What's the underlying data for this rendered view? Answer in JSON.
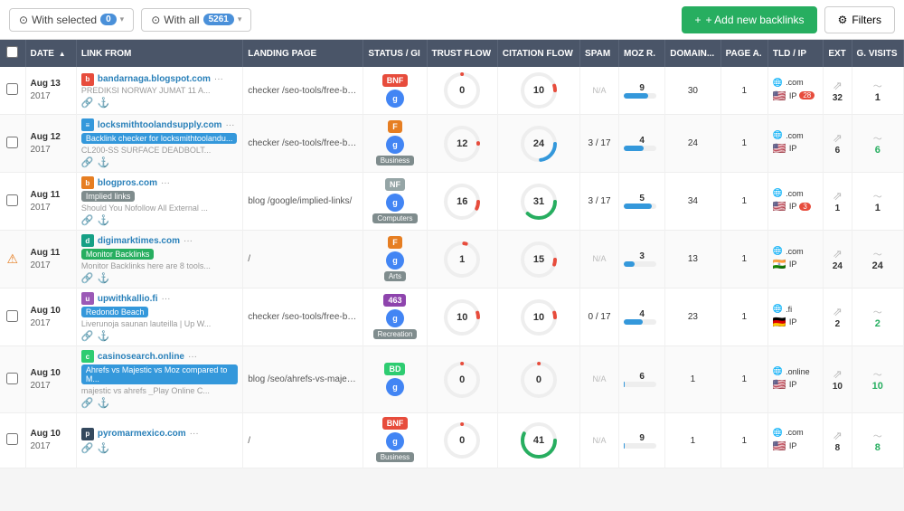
{
  "topbar": {
    "selected_label": "With selected",
    "selected_count": "0",
    "all_label": "With all",
    "all_count": "5261",
    "add_btn": "+ Add new backlinks",
    "filters_btn": "Filters"
  },
  "table": {
    "columns": [
      "DATE",
      "LINK FROM",
      "LANDING PAGE",
      "STATUS / GI",
      "TRUST FLOW",
      "CITATION FLOW",
      "SPAM",
      "MOZ R.",
      "DOMAIN...",
      "PAGE A.",
      "TLD / IP",
      "EXT",
      "G. VISITS"
    ],
    "rows": [
      {
        "date": "Aug 13\n2017",
        "domain": "bandarnaga.blogspot.com",
        "tag": "PREDIKSI NORWAY JUMAT 11 A...",
        "tag_color": "",
        "tag_label": "",
        "snippet": "PREDIKSI NORWAY JUMAT 11 A...",
        "landing": "checker /seo-tools/free-bac...",
        "status": "BNF",
        "status_class": "s-bnf",
        "trust": 0,
        "citation": 10,
        "trust_color": "#e74c3c",
        "citation_color": "#e74c3c",
        "spam": "N/A",
        "moz": 9,
        "moz_max": 30,
        "moz_bar": 30,
        "domain_a": 30,
        "page_a": 1,
        "tld": ".com",
        "flag": "🇺🇸",
        "ip_count": 28,
        "ext": 32,
        "visits": 1,
        "visits_color": "",
        "flow_label": "",
        "favicon_type": "letter",
        "favicon_color": "#e74c3c",
        "favicon_letter": "b",
        "warn": false
      },
      {
        "date": "Aug 12\n2017",
        "domain": "locksmithtoolandsupply.com",
        "tag": "Backlink checker for locksmithtoolandu...",
        "tag_color": "tag-blue",
        "tag_label": "Backlink checker for locksmithtoolandu...",
        "snippet": "CL200-SS SURFACE DEADBOLT...",
        "landing": "checker /seo-tools/free-bac...",
        "status": "F",
        "status_class": "s-f",
        "trust": 12,
        "citation": 24,
        "trust_color": "#e74c3c",
        "citation_color": "#3498db",
        "spam": "3 / 17",
        "moz": 4,
        "moz_max": 24,
        "moz_bar": 24,
        "domain_a": 24,
        "page_a": 1,
        "tld": ".com",
        "flag": "🇺🇸",
        "ip_count": 0,
        "ext": 6,
        "visits": 6,
        "visits_color": "gv-green",
        "flow_label": "Business",
        "favicon_type": "letter",
        "favicon_color": "#3498db",
        "favicon_letter": "≡",
        "warn": false
      },
      {
        "date": "Aug 11\n2017",
        "domain": "blogpros.com",
        "tag": "Implied links",
        "tag_color": "tag-gray",
        "tag_label": "Implied links",
        "snippet": "Should You Nofollow All External ...",
        "landing": "blog /google/implied-links/",
        "status": "NF",
        "status_class": "s-nf",
        "trust": 16,
        "citation": 31,
        "trust_color": "#e74c3c",
        "citation_color": "#27ae60",
        "spam": "3 / 17",
        "moz": 5,
        "moz_max": 34,
        "moz_bar": 34,
        "domain_a": 34,
        "page_a": 1,
        "tld": ".com",
        "flag": "🇺🇸",
        "ip_count": 3,
        "ext": 1,
        "visits": 1,
        "visits_color": "",
        "flow_label": "Computers",
        "favicon_type": "letter",
        "favicon_color": "#e67e22",
        "favicon_letter": "b",
        "warn": false
      },
      {
        "date": "Aug 11\n2017",
        "domain": "digimarktimes.com",
        "tag": "Monitor Backlinks",
        "tag_color": "tag-green",
        "tag_label": "Monitor Backlinks",
        "snippet": "Monitor Backlinks here are 8 tools...",
        "landing": "/",
        "status": "F",
        "status_class": "s-f",
        "trust": 1,
        "citation": 15,
        "trust_color": "#e74c3c",
        "citation_color": "#e74c3c",
        "spam": "N/A",
        "moz": 3,
        "moz_max": 13,
        "moz_bar": 13,
        "domain_a": 13,
        "page_a": 1,
        "tld": ".com",
        "flag": "🇮🇳",
        "ip_count": 0,
        "ext": 24,
        "visits": 24,
        "visits_color": "",
        "flow_label": "Arts",
        "favicon_type": "letter",
        "favicon_color": "#16a085",
        "favicon_letter": "d",
        "warn": true
      },
      {
        "date": "Aug 10\n2017",
        "domain": "upwithkallio.fi",
        "tag": "Redondo Beach",
        "tag_color": "tag-blue",
        "tag_label": "Redondo Beach",
        "snippet": "Liverunoja saunan lauteilla | Up W...",
        "landing": "checker /seo-tools/free-bac...",
        "status": "463",
        "status_class": "s-463",
        "trust": 10,
        "citation": 10,
        "trust_color": "#e74c3c",
        "citation_color": "#e74c3c",
        "spam": "0 / 17",
        "moz": 4,
        "moz_max": 23,
        "moz_bar": 23,
        "domain_a": 23,
        "page_a": 1,
        "tld": ".fi",
        "flag": "🇩🇪",
        "ip_count": 0,
        "ext": 2,
        "visits": 2,
        "visits_color": "gv-green",
        "flow_label": "Recreation",
        "favicon_type": "letter",
        "favicon_color": "#9b59b6",
        "favicon_letter": "u",
        "warn": false
      },
      {
        "date": "Aug 10\n2017",
        "domain": "casinosearch.online",
        "tag": "Ahrefs vs Majestic vs Moz compared to M...",
        "tag_color": "tag-blue",
        "tag_label": "Ahrefs vs Majestic vs Moz compared to M...",
        "snippet": "majestic vs ahrefs _Play Online C...",
        "landing": "blog /seo/ahrefs-vs-majesti...",
        "status": "BD",
        "status_class": "s-bd",
        "trust": 0,
        "citation": 0,
        "trust_color": "#e74c3c",
        "citation_color": "#e74c3c",
        "spam": "N/A",
        "moz": 6,
        "moz_max": 1,
        "moz_bar": 1,
        "domain_a": 1,
        "page_a": 1,
        "tld": ".online",
        "flag": "🇺🇸",
        "ip_count": 0,
        "ext": 10,
        "visits": 10,
        "visits_color": "gv-green",
        "flow_label": "",
        "favicon_type": "letter",
        "favicon_color": "#2ecc71",
        "favicon_letter": "c",
        "warn": false
      },
      {
        "date": "Aug 10\n2017",
        "domain": "pyromarmexico.com",
        "tag": "",
        "tag_color": "",
        "tag_label": "",
        "snippet": "",
        "landing": "/",
        "status": "BNF",
        "status_class": "s-bnf",
        "trust": 0,
        "citation": 41,
        "trust_color": "#e74c3c",
        "citation_color": "#27ae60",
        "spam": "N/A",
        "moz": 9,
        "moz_max": 1,
        "moz_bar": 1,
        "domain_a": 1,
        "page_a": 1,
        "tld": ".com",
        "flag": "🇺🇸",
        "ip_count": 0,
        "ext": 8,
        "visits": 8,
        "visits_color": "gv-green",
        "flow_label": "Business",
        "favicon_type": "letter",
        "favicon_color": "#34495e",
        "favicon_letter": "p",
        "warn": false
      }
    ]
  }
}
